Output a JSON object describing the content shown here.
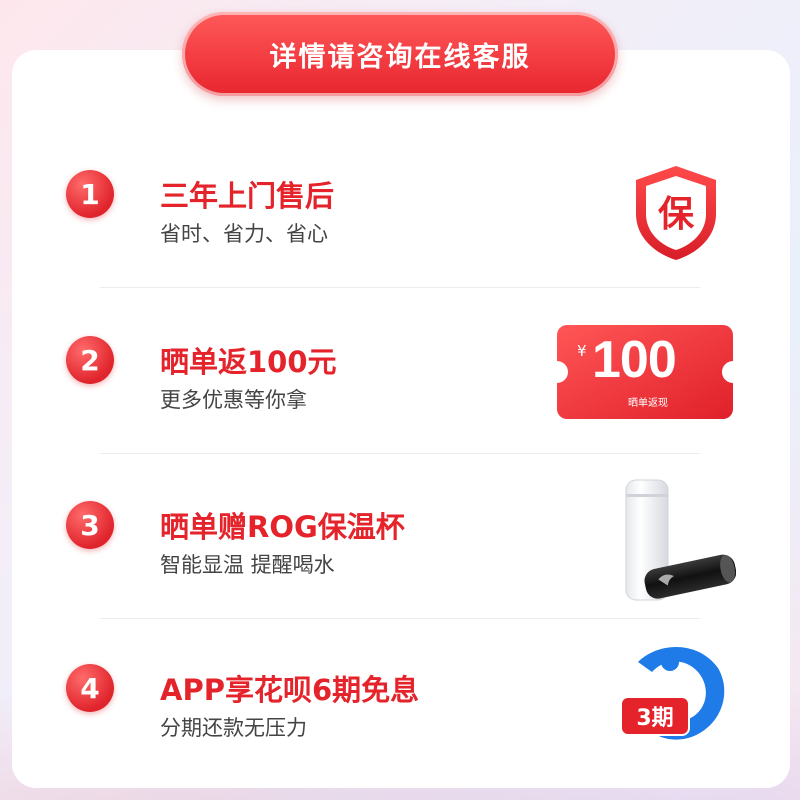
{
  "banner": {
    "text": "详情请咨询在线客服"
  },
  "items": [
    {
      "number": "1",
      "title": "三年上门售后",
      "subtitle": "省时、省力、省心",
      "icon": "shield-icon",
      "icon_text": "保"
    },
    {
      "number": "2",
      "title": "晒单返100元",
      "subtitle": "更多优惠等你拿",
      "icon": "coupon-icon"
    },
    {
      "number": "3",
      "title": "晒单赠ROG保温杯",
      "subtitle": "智能显温 提醒喝水",
      "icon": "thermos-cup-image"
    },
    {
      "number": "4",
      "title": "APP享花呗6期免息",
      "subtitle": "分期还款无压力",
      "icon": "huabei-icon",
      "icon_text": "3期"
    }
  ],
  "coupon": {
    "currency": "¥",
    "value": "100",
    "note": "晒单返现"
  },
  "colors": {
    "accent": "#e5232b",
    "text": "#444444"
  }
}
